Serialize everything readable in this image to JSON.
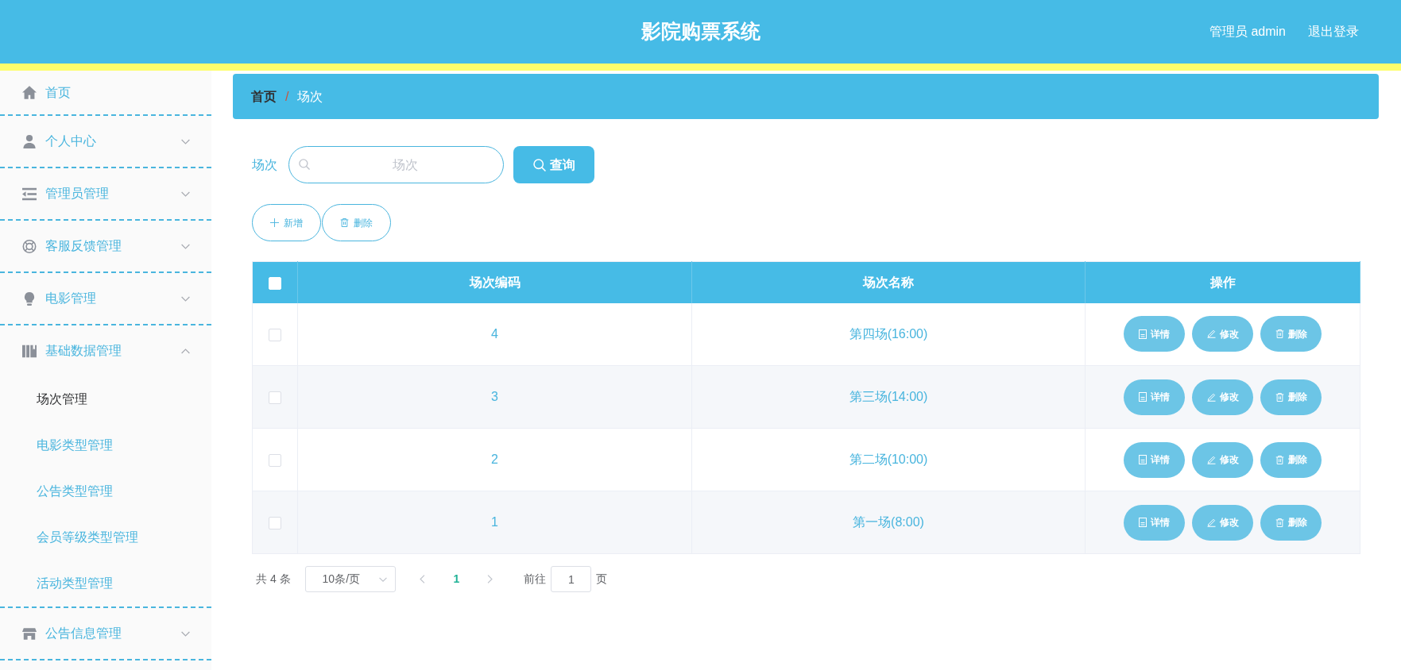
{
  "header": {
    "title": "影院购票系统",
    "user": "管理员 admin",
    "logout": "退出登录"
  },
  "sidebar": {
    "items": [
      {
        "kind": "link",
        "label": "首页"
      },
      {
        "kind": "menu",
        "label": "个人中心",
        "expanded": false
      },
      {
        "kind": "menu",
        "label": "管理员管理",
        "expanded": false
      },
      {
        "kind": "menu",
        "label": "客服反馈管理",
        "expanded": false
      },
      {
        "kind": "menu",
        "label": "电影管理",
        "expanded": false
      },
      {
        "kind": "menu",
        "label": "基础数据管理",
        "expanded": true,
        "children": [
          {
            "label": "场次管理",
            "selected": true
          },
          {
            "label": "电影类型管理",
            "selected": false
          },
          {
            "label": "公告类型管理",
            "selected": false
          },
          {
            "label": "会员等级类型管理",
            "selected": false
          },
          {
            "label": "活动类型管理",
            "selected": false
          }
        ]
      },
      {
        "kind": "menu",
        "label": "公告信息管理",
        "expanded": false
      }
    ]
  },
  "breadcrumb": {
    "items": [
      "首页",
      "场次"
    ],
    "separator": "/"
  },
  "search": {
    "label": "场次",
    "placeholder": "场次",
    "button": "查询"
  },
  "toolbar": {
    "buttons": [
      "新增",
      "删除"
    ]
  },
  "table": {
    "select_all": false,
    "columns": [
      "场次编码",
      "场次名称",
      "操作"
    ],
    "rows": [
      {
        "checked": false,
        "code": "4",
        "name": "第四场(16:00)",
        "actions": [
          "详情",
          "修改",
          "删除"
        ]
      },
      {
        "checked": false,
        "code": "3",
        "name": "第三场(14:00)",
        "actions": [
          "详情",
          "修改",
          "删除"
        ]
      },
      {
        "checked": false,
        "code": "2",
        "name": "第二场(10:00)",
        "actions": [
          "详情",
          "修改",
          "删除"
        ]
      },
      {
        "checked": false,
        "code": "1",
        "name": "第一场(8:00)",
        "actions": [
          "详情",
          "修改",
          "删除"
        ]
      }
    ]
  },
  "pagination": {
    "total": "共 4 条",
    "page_size": "10条/页",
    "pages": [
      {
        "label": "1",
        "selected": true
      }
    ],
    "goto_label": "前往",
    "goto_value": "1",
    "goto_suffix": "页"
  }
}
